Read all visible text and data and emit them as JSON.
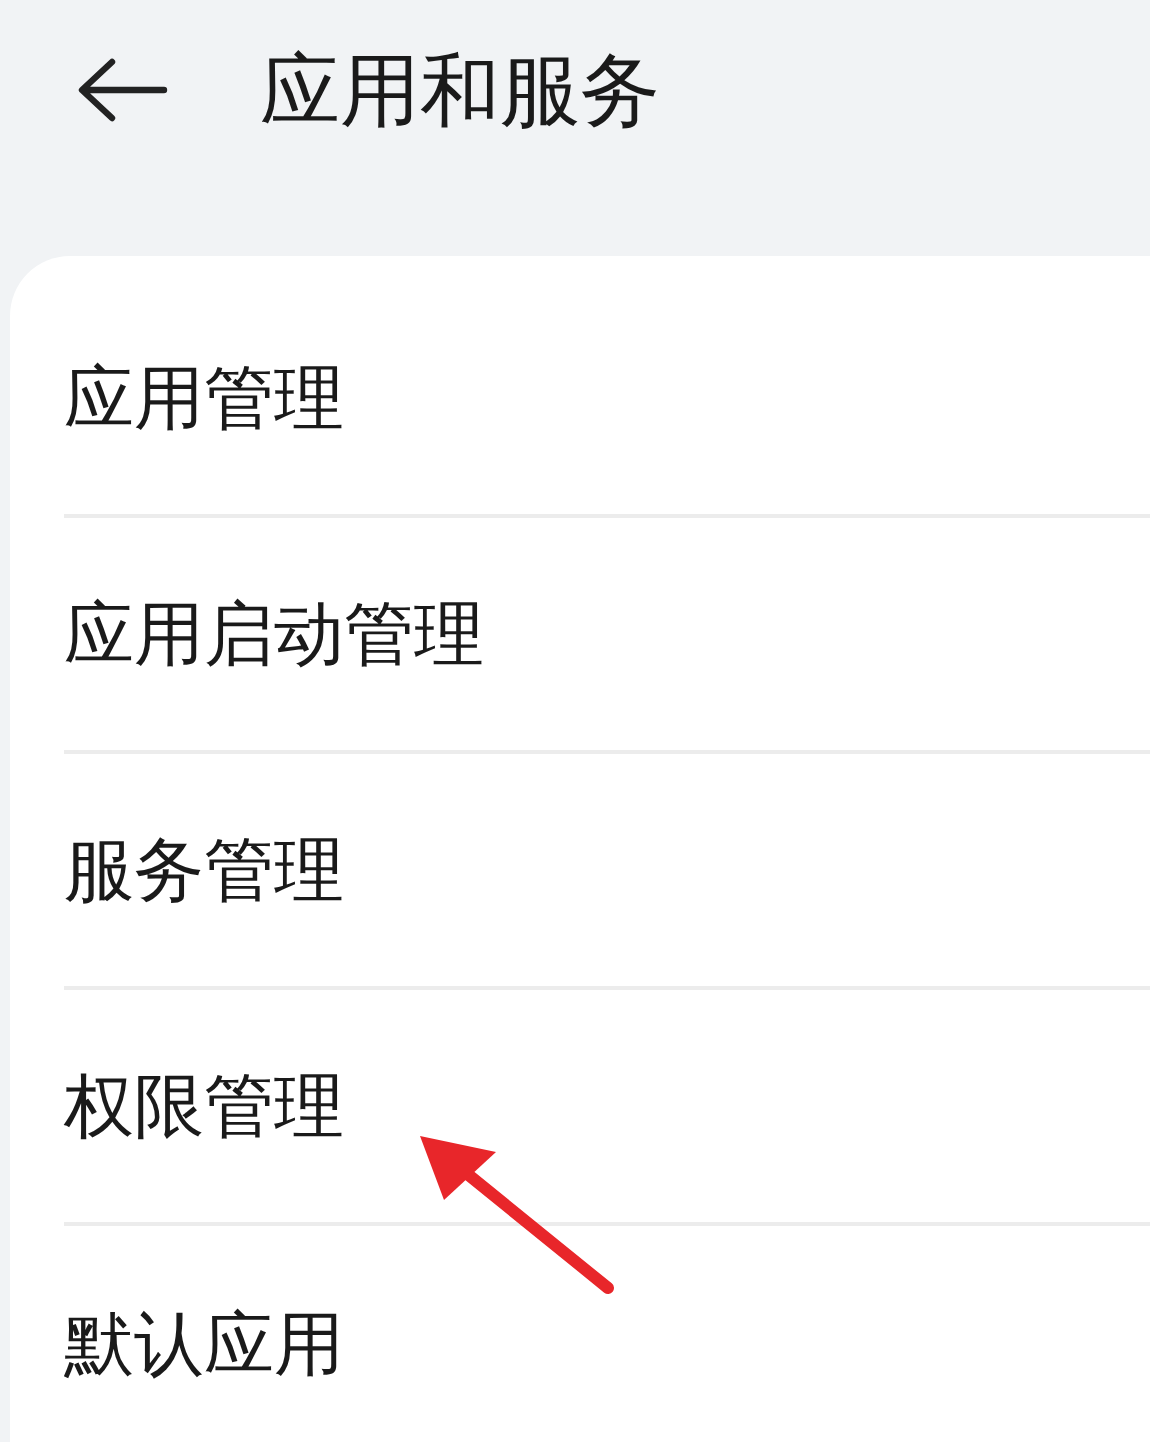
{
  "header": {
    "title": "应用和服务"
  },
  "items": [
    {
      "label": "应用管理"
    },
    {
      "label": "应用启动管理"
    },
    {
      "label": "服务管理"
    },
    {
      "label": "权限管理"
    },
    {
      "label": "默认应用"
    }
  ]
}
